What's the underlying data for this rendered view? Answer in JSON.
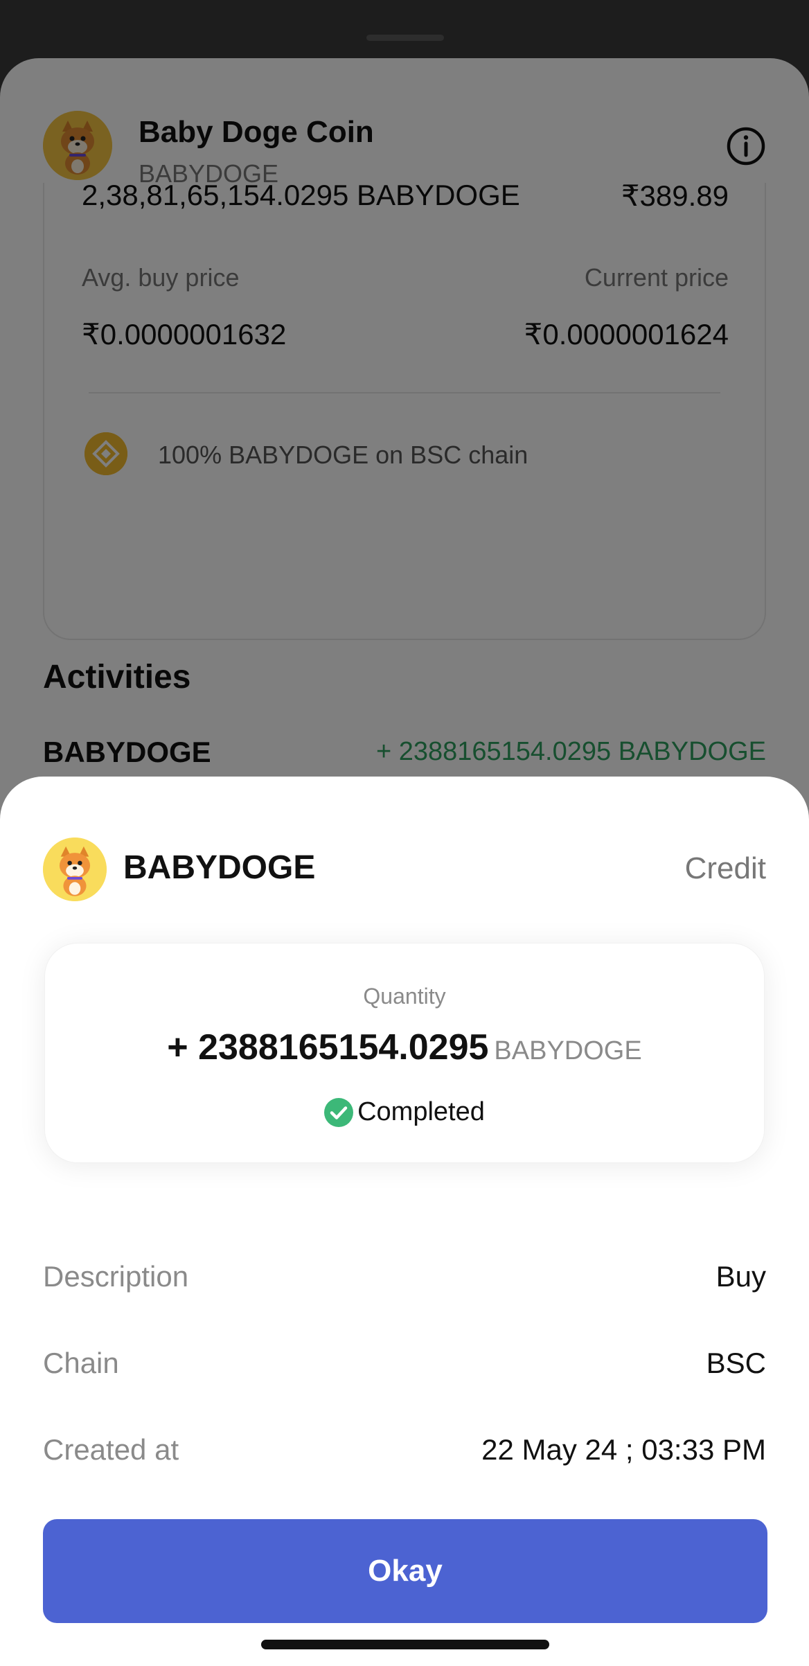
{
  "background": {
    "coin_name": "Baby Doge Coin",
    "coin_symbol": "BABYDOGE",
    "holding": {
      "quantity": "2,38,81,65,154.0295 BABYDOGE",
      "value": "₹389.89",
      "avg_buy_label": "Avg. buy price",
      "current_label": "Current price",
      "avg_buy_value": "₹0.0000001632",
      "current_value": "₹0.0000001624",
      "chain_note": "100% BABYDOGE on BSC chain"
    },
    "activities_title": "Activities",
    "activity": {
      "name": "BABYDOGE",
      "amount": "+ 2388165154.0295 BABYDOGE"
    }
  },
  "modal": {
    "coin_name": "BABYDOGE",
    "type": "Credit",
    "quantity_label": "Quantity",
    "quantity_value": "+ 2388165154.0295",
    "quantity_unit": "BABYDOGE",
    "status": "Completed",
    "details": [
      {
        "label": "Description",
        "value": "Buy"
      },
      {
        "label": "Chain",
        "value": "BSC"
      },
      {
        "label": "Created at",
        "value": "22 May 24 ; 03:33 PM"
      }
    ],
    "okay_label": "Okay"
  },
  "colors": {
    "primary_button": "#4c63d2",
    "credit_green": "#2f9e5f",
    "status_check": "#3cb878"
  }
}
